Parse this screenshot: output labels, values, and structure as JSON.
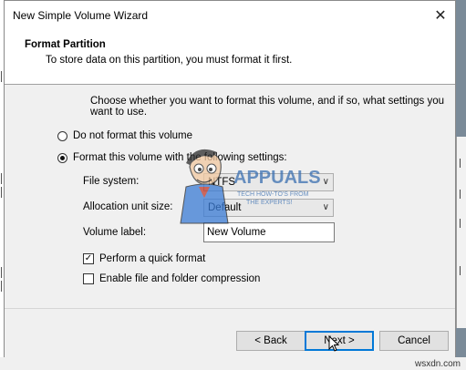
{
  "window": {
    "title": "New Simple Volume Wizard",
    "close_glyph": "✕"
  },
  "header": {
    "title": "Format Partition",
    "subtitle": "To store data on this partition, you must format it first."
  },
  "main": {
    "intro": "Choose whether you want to format this volume, and if so, what settings you want to use.",
    "option_no_format": "Do not format this volume",
    "option_format": "Format this volume with the following settings:",
    "selected_option": "option_format",
    "file_system_label": "File system:",
    "file_system_value": "NTFS",
    "allocation_label": "Allocation unit size:",
    "allocation_value": "Default",
    "volume_label_label": "Volume label:",
    "volume_label_value": "New Volume",
    "quick_format_label": "Perform a quick format",
    "quick_format_checked": true,
    "compression_label": "Enable file and folder compression",
    "compression_checked": false
  },
  "buttons": {
    "back": "< Back",
    "next": "Next >",
    "cancel": "Cancel"
  },
  "logo": {
    "name": "APPUALS",
    "tagline_1": "TECH HOW-TO'S FROM",
    "tagline_2": "THE EXPERTS!"
  },
  "watermark": "wsxdn.com",
  "colors": {
    "accent": "#0078d7",
    "dialog_bg": "#f0f0f0",
    "header_bg": "#ffffff"
  }
}
